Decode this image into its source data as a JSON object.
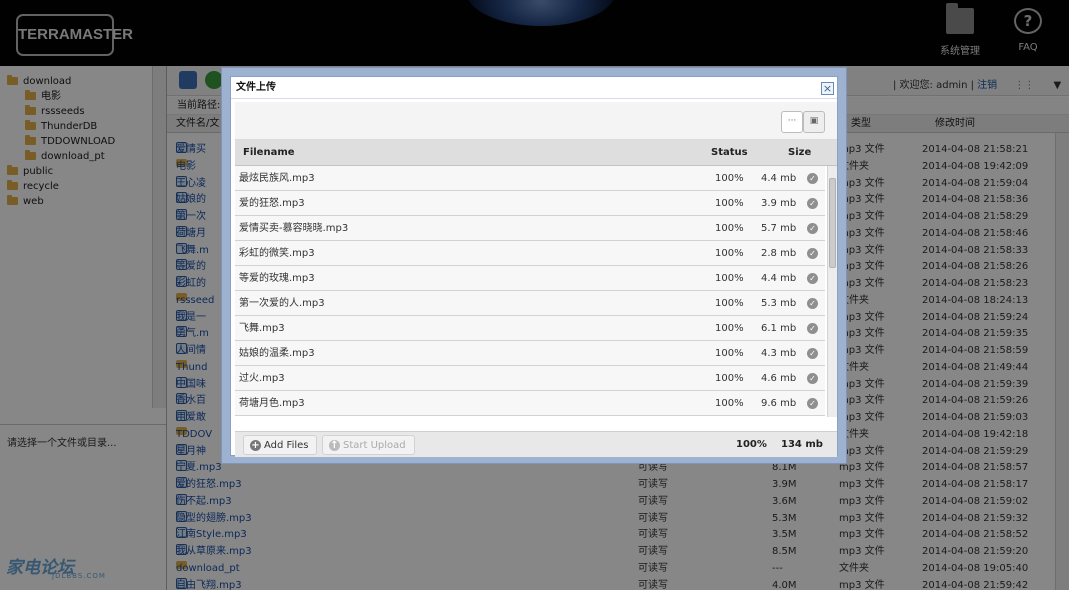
{
  "header": {
    "logo": "TERRAMASTER",
    "system_label": "系统管理",
    "faq_label": "FAQ",
    "faq_glyph": "?"
  },
  "sidebar": {
    "tree": [
      {
        "label": "download",
        "depth": 0
      },
      {
        "label": "电影",
        "depth": 1
      },
      {
        "label": "rssseeds",
        "depth": 1
      },
      {
        "label": "ThunderDB",
        "depth": 1
      },
      {
        "label": "TDDOWNLOAD",
        "depth": 1
      },
      {
        "label": "download_pt",
        "depth": 1
      },
      {
        "label": "public",
        "depth": 0
      },
      {
        "label": "recycle",
        "depth": 0
      },
      {
        "label": "web",
        "depth": 0
      }
    ],
    "hint": "请选择一个文件或目录...",
    "watermark": "家电论坛",
    "watermark_sub": "JDLBBS.COM"
  },
  "main": {
    "welcome_prefix": "| 欢迎您: admin | ",
    "logout": "注销",
    "path_label": "当前路径:",
    "columns": {
      "name": "文件名/文",
      "type": "类型",
      "mtime": "修改时间"
    },
    "rows": [
      {
        "name": "爱情买",
        "perm": "",
        "size": "",
        "type": "mp3 文件",
        "time": "2014-04-08 21:58:21",
        "dir": false
      },
      {
        "name": "电影",
        "perm": "",
        "size": "",
        "type": "文件夹",
        "time": "2014-04-08 19:42:09",
        "dir": true
      },
      {
        "name": "王心凌",
        "perm": "",
        "size": "",
        "type": "mp3 文件",
        "time": "2014-04-08 21:59:04",
        "dir": false
      },
      {
        "name": "姑娘的",
        "perm": "",
        "size": "",
        "type": "mp3 文件",
        "time": "2014-04-08 21:58:36",
        "dir": false
      },
      {
        "name": "第一次",
        "perm": "",
        "size": "",
        "type": "mp3 文件",
        "time": "2014-04-08 21:58:29",
        "dir": false
      },
      {
        "name": "荷塘月",
        "perm": "",
        "size": "",
        "type": "mp3 文件",
        "time": "2014-04-08 21:58:46",
        "dir": false
      },
      {
        "name": "飞舞.m",
        "perm": "",
        "size": "",
        "type": "mp3 文件",
        "time": "2014-04-08 21:58:33",
        "dir": false
      },
      {
        "name": "等爱的",
        "perm": "",
        "size": "",
        "type": "mp3 文件",
        "time": "2014-04-08 21:58:26",
        "dir": false
      },
      {
        "name": "彩虹的",
        "perm": "",
        "size": "",
        "type": "mp3 文件",
        "time": "2014-04-08 21:58:23",
        "dir": false
      },
      {
        "name": "rssseed",
        "perm": "",
        "size": "",
        "type": "文件夹",
        "time": "2014-04-08 18:24:13",
        "dir": true
      },
      {
        "name": "我是一",
        "perm": "",
        "size": "",
        "type": "mp3 文件",
        "time": "2014-04-08 21:59:24",
        "dir": false
      },
      {
        "name": "勇气.m",
        "perm": "",
        "size": "",
        "type": "mp3 文件",
        "time": "2014-04-08 21:59:35",
        "dir": false
      },
      {
        "name": "人间情",
        "perm": "",
        "size": "",
        "type": "mp3 文件",
        "time": "2014-04-08 21:58:59",
        "dir": false
      },
      {
        "name": "Thund",
        "perm": "",
        "size": "",
        "type": "文件夹",
        "time": "2014-04-08 21:49:44",
        "dir": true
      },
      {
        "name": "中国味",
        "perm": "",
        "size": "",
        "type": "mp3 文件",
        "time": "2014-04-08 21:59:39",
        "dir": false
      },
      {
        "name": "香水百",
        "perm": "",
        "size": "",
        "type": "mp3 文件",
        "time": "2014-04-08 21:59:26",
        "dir": false
      },
      {
        "name": "用爱敢",
        "perm": "",
        "size": "",
        "type": "mp3 文件",
        "time": "2014-04-08 21:59:03",
        "dir": false
      },
      {
        "name": "TDDOV",
        "perm": "",
        "size": "",
        "type": "文件夹",
        "time": "2014-04-08 19:42:18",
        "dir": true
      },
      {
        "name": "星月神",
        "perm": "",
        "size": "",
        "type": "mp3 文件",
        "time": "2014-04-08 21:59:29",
        "dir": false
      },
      {
        "name": "宁夏.mp3",
        "perm": "可读写",
        "size": "8.1M",
        "type": "mp3 文件",
        "time": "2014-04-08 21:58:57",
        "dir": false
      },
      {
        "name": "爱的狂怒.mp3",
        "perm": "可读写",
        "size": "3.9M",
        "type": "mp3 文件",
        "time": "2014-04-08 21:58:17",
        "dir": false
      },
      {
        "name": "伤不起.mp3",
        "perm": "可读写",
        "size": "3.6M",
        "type": "mp3 文件",
        "time": "2014-04-08 21:59:02",
        "dir": false
      },
      {
        "name": "隐型的翅膀.mp3",
        "perm": "可读写",
        "size": "5.3M",
        "type": "mp3 文件",
        "time": "2014-04-08 21:59:32",
        "dir": false
      },
      {
        "name": "江南Style.mp3",
        "perm": "可读写",
        "size": "3.5M",
        "type": "mp3 文件",
        "time": "2014-04-08 21:58:52",
        "dir": false
      },
      {
        "name": "我从草原来.mp3",
        "perm": "可读写",
        "size": "8.5M",
        "type": "mp3 文件",
        "time": "2014-04-08 21:59:20",
        "dir": false
      },
      {
        "name": "download_pt",
        "perm": "可读写",
        "size": "---",
        "type": "文件夹",
        "time": "2014-04-08 19:05:40",
        "dir": true
      },
      {
        "name": "自由飞翔.mp3",
        "perm": "可读写",
        "size": "4.0M",
        "type": "mp3 文件",
        "time": "2014-04-08 21:59:42",
        "dir": false
      }
    ]
  },
  "dialog": {
    "title": "文件上传",
    "close_glyph": "×",
    "view_list_glyph": "···",
    "view_thumb_glyph": "▣",
    "columns": {
      "filename": "Filename",
      "status": "Status",
      "size": "Size"
    },
    "files": [
      {
        "name": "最炫民族风.mp3",
        "status": "100%",
        "size": "4.4 mb"
      },
      {
        "name": "爱的狂怒.mp3",
        "status": "100%",
        "size": "3.9 mb"
      },
      {
        "name": "爱情买卖-慕容晓晓.mp3",
        "status": "100%",
        "size": "5.7 mb"
      },
      {
        "name": "彩虹的微笑.mp3",
        "status": "100%",
        "size": "2.8 mb"
      },
      {
        "name": "等爱的玫瑰.mp3",
        "status": "100%",
        "size": "4.4 mb"
      },
      {
        "name": "第一次爱的人.mp3",
        "status": "100%",
        "size": "5.3 mb"
      },
      {
        "name": "飞舞.mp3",
        "status": "100%",
        "size": "6.1 mb"
      },
      {
        "name": "姑娘的温柔.mp3",
        "status": "100%",
        "size": "4.3 mb"
      },
      {
        "name": "过火.mp3",
        "status": "100%",
        "size": "4.6 mb"
      },
      {
        "name": "荷塘月色.mp3",
        "status": "100%",
        "size": "9.6 mb"
      }
    ],
    "add_files": "Add Files",
    "start_upload": "Start Upload",
    "total_status": "100%",
    "total_size": "134 mb"
  }
}
